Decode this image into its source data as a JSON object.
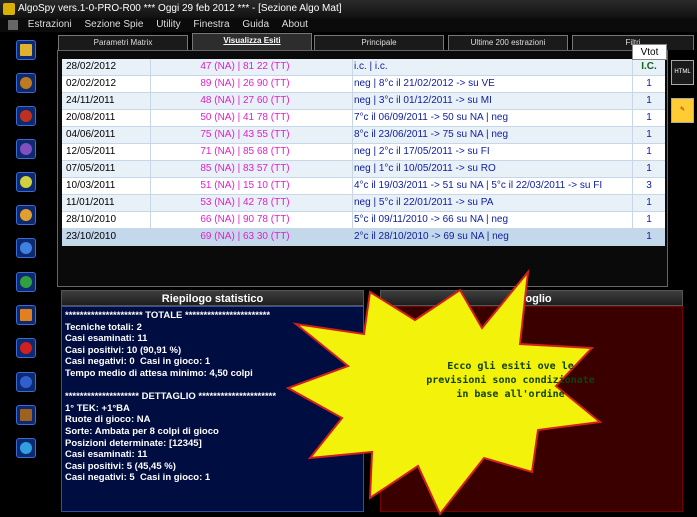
{
  "window": {
    "title": "AlgoSpy vers.1-0-PRO-R00  ***  Oggi 29 feb 2012  ***  - [Sezione Algo Mat]"
  },
  "menu": [
    "Estrazioni",
    "Sezione Spie",
    "Utility",
    "Finestra",
    "Guida",
    "About"
  ],
  "tabs": [
    "Parametri Matrix",
    "Visualizza Esiti",
    "Principale",
    "Ultime 200 estrazioni",
    "Filtri"
  ],
  "active_tab": "Visualizza Esiti",
  "vtot_label": "Vtot",
  "grid": {
    "rows": [
      {
        "date": "28/02/2012",
        "nums": "47 (NA) | 81 22 (TT)",
        "desc": "i.c. | i.c.",
        "v": "I.C."
      },
      {
        "date": "02/02/2012",
        "nums": "89 (NA) | 26 90 (TT)",
        "desc": "neg | 8°c il 21/02/2012 -> su VE",
        "v": "1"
      },
      {
        "date": "24/11/2011",
        "nums": "48 (NA) | 27 60 (TT)",
        "desc": "neg | 3°c il 01/12/2011 -> su MI",
        "v": "1"
      },
      {
        "date": "20/08/2011",
        "nums": "50 (NA) | 41 78 (TT)",
        "desc": "7°c il 06/09/2011 -> 50 su NA | neg",
        "v": "1"
      },
      {
        "date": "04/06/2011",
        "nums": "75 (NA) | 43 55 (TT)",
        "desc": "8°c il 23/06/2011 -> 75 su NA | neg",
        "v": "1"
      },
      {
        "date": "12/05/2011",
        "nums": "71 (NA) | 85 68 (TT)",
        "desc": "neg | 2°c il 17/05/2011 -> su FI",
        "v": "1"
      },
      {
        "date": "07/05/2011",
        "nums": "85 (NA) | 83 57 (TT)",
        "desc": "neg | 1°c il 10/05/2011 -> su RO",
        "v": "1"
      },
      {
        "date": "10/03/2011",
        "nums": "51 (NA) | 15 10 (TT)",
        "desc": "4°c il 19/03/2011 -> 51 su NA | 5°c il 22/03/2011 -> su FI",
        "v": "3"
      },
      {
        "date": "11/01/2011",
        "nums": "53 (NA) | 42 78 (TT)",
        "desc": "neg | 5°c il 22/01/2011 -> su PA",
        "v": "1"
      },
      {
        "date": "28/10/2010",
        "nums": "66 (NA) | 90 78 (TT)",
        "desc": "5°c il 09/11/2010 -> 66 su NA | neg",
        "v": "1"
      },
      {
        "date": "23/10/2010",
        "nums": "69 (NA) | 63 30 (TT)",
        "desc": "2°c il 28/10/2010 -> 69 su NA | neg",
        "v": "1"
      }
    ]
  },
  "right_icons": [
    "HTML",
    "export"
  ],
  "riepilogo": {
    "title": "Riepilogo statistico",
    "lines": [
      "********************* TOTALE ***********************",
      "Tecniche totali: 2",
      "Casi esaminati: 11",
      "Casi positivi: 10 (90,91 %)",
      "Casi negativi: 0  Casi in gioco: 1",
      "Tempo medio di attesa minimo: 4,50 colpi",
      "",
      "******************** DETTAGLIO *********************",
      "1° TEK: +1°BA",
      "Ruote di gioco: NA",
      "Sorte: Ambata per 8 colpi di gioco",
      "Posizioni determinate: [12345]",
      "Casi esaminati: 11",
      "Casi positivi: 5 (45,45 %)",
      "Casi negativi: 5  Casi in gioco: 1"
    ]
  },
  "spoglio": {
    "title": "Spoglio"
  },
  "callout": "Ecco gli esiti ove le previsioni sono condizionate in base all'ordine",
  "colors": {
    "date": "#000000",
    "nums": "#e020c8",
    "desc": "#1020a0",
    "burst_fill": "#f2f20a",
    "burst_stroke": "#d02020"
  }
}
